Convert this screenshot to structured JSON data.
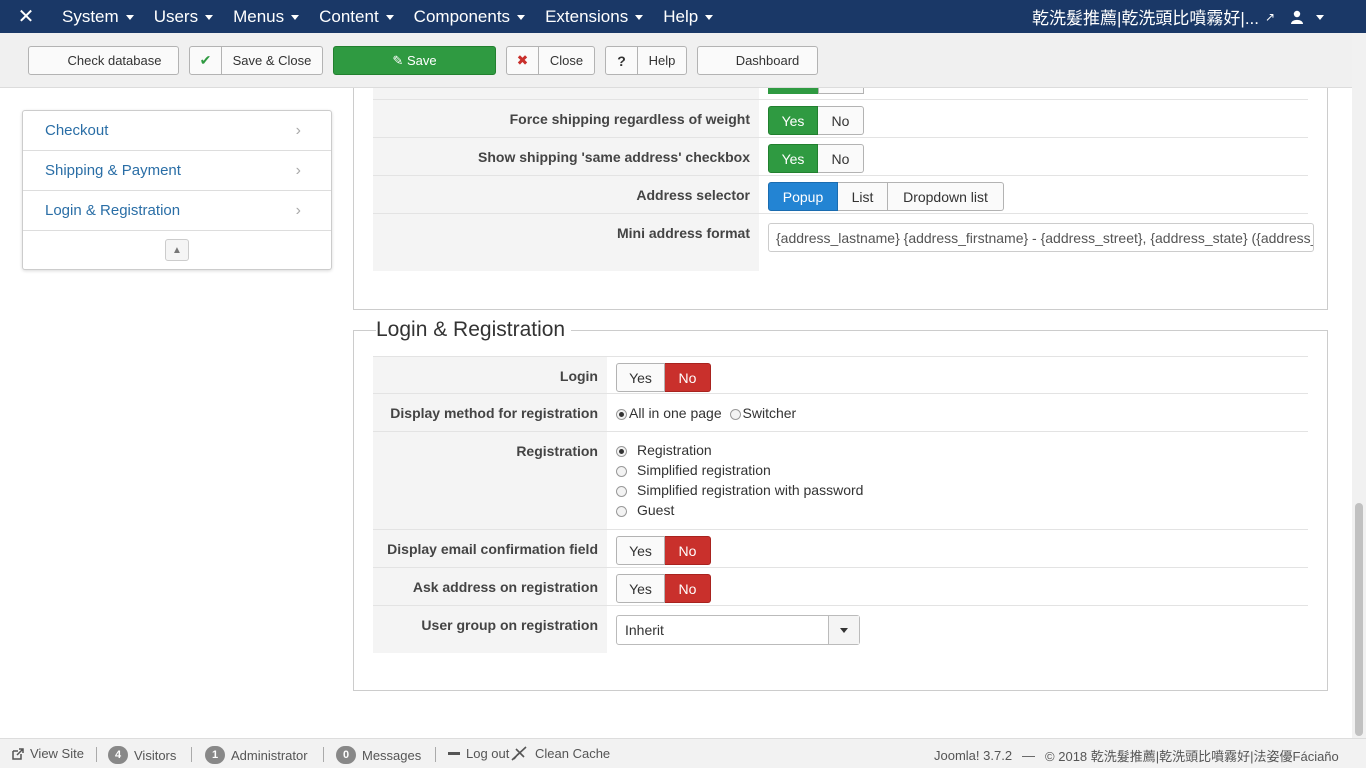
{
  "navbar": {
    "logo": "✕",
    "menu": [
      "System",
      "Users",
      "Menus",
      "Content",
      "Components",
      "Extensions",
      "Help"
    ],
    "site_title": "乾洗髮推薦|乾洗頭比噴霧好|...",
    "ext_icon": "↗",
    "user_icon": "user-icon"
  },
  "toolbar": {
    "check_database": "Check database",
    "save_close": "Save & Close",
    "save": "Save",
    "close": "Close",
    "help": "Help",
    "dashboard": "Dashboard",
    "check_icon": "✔",
    "save_icon": "✎",
    "close_icon": "✖",
    "help_icon": "?"
  },
  "sidebar": {
    "items": [
      "Checkout",
      "Shipping & Payment",
      "Login & Registration"
    ],
    "chevron": "›",
    "collapse_icon": "▲"
  },
  "shipping": {
    "force_label": "Force shipping regardless of weight",
    "same_addr_label": "Show shipping 'same address' checkbox",
    "addr_selector_label": "Address selector",
    "mini_addr_label": "Mini address format",
    "mini_addr_value": "{address_lastname} {address_firstname} - {address_street}, {address_state} ({address_country})",
    "yes": "Yes",
    "no": "No",
    "popup": "Popup",
    "list": "List",
    "dropdown": "Dropdown list"
  },
  "login": {
    "legend": "Login & Registration",
    "login_label": "Login",
    "display_method_label": "Display method for registration",
    "display_opt1": "All in one page",
    "display_opt2": "Switcher",
    "registration_label": "Registration",
    "reg_opts": [
      "Registration",
      "Simplified registration",
      "Simplified registration with password",
      "Guest"
    ],
    "email_confirm_label": "Display email confirmation field",
    "ask_address_label": "Ask address on registration",
    "user_group_label": "User group on registration",
    "user_group_value": "Inherit",
    "yes": "Yes",
    "no": "No"
  },
  "status": {
    "view_site": "View Site",
    "visitors_count": "4",
    "visitors": "Visitors",
    "admin_count": "1",
    "admin": "Administrator",
    "messages_count": "0",
    "messages": "Messages",
    "logout": "Log out",
    "clean_cache": "Clean Cache",
    "version": "Joomla! 3.7.2",
    "copyright": "© 2018 乾洗髮推薦|乾洗頭比噴霧好|法姿優Fáciaño",
    "dash": "—"
  },
  "colors": {
    "navbar": "#1a3867",
    "green": "#2f9a41",
    "red": "#c9302c",
    "blue": "#2384d3",
    "link": "#2a6ea6"
  }
}
